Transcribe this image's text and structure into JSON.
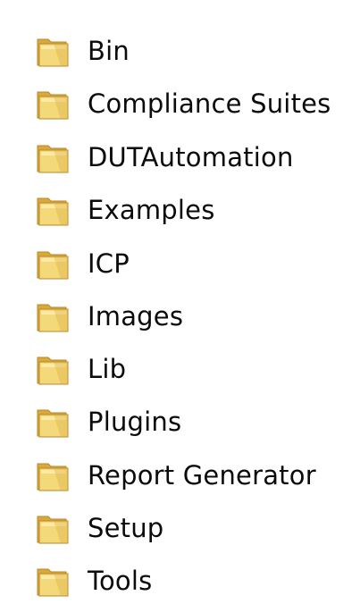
{
  "folders": [
    {
      "name": "Bin",
      "icon": "folder-icon"
    },
    {
      "name": "Compliance Suites",
      "icon": "folder-icon"
    },
    {
      "name": "DUTAutomation",
      "icon": "folder-icon"
    },
    {
      "name": "Examples",
      "icon": "folder-icon"
    },
    {
      "name": "ICP",
      "icon": "folder-icon"
    },
    {
      "name": "Images",
      "icon": "folder-icon"
    },
    {
      "name": "Lib",
      "icon": "folder-icon"
    },
    {
      "name": "Plugins",
      "icon": "folder-icon"
    },
    {
      "name": "Report Generator",
      "icon": "folder-icon"
    },
    {
      "name": "Setup",
      "icon": "folder-icon"
    },
    {
      "name": "Tools",
      "icon": "folder-icon"
    }
  ],
  "colors": {
    "folder_back": "#d9a93a",
    "folder_front": "#f3d97a",
    "folder_highlight": "#fbeeb2",
    "folder_edge": "#b8862a",
    "text": "#0b0b0b",
    "background": "#ffffff"
  }
}
